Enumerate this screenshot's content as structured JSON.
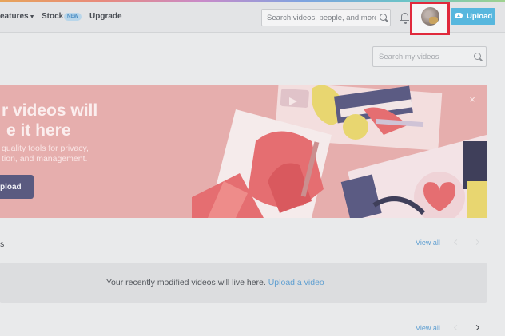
{
  "nav": {
    "features": "eatures",
    "stock": "Stock",
    "new_badge": "NEW",
    "upgrade": "Upgrade"
  },
  "search": {
    "placeholder": "Search videos, people, and more"
  },
  "header": {
    "upload_label": "Upload"
  },
  "library": {
    "search_placeholder": "Search my videos"
  },
  "banner": {
    "headline_1": "r videos will",
    "headline_2": "e it here",
    "body_1": "quality tools for privacy,",
    "body_2": "tion, and management.",
    "cta": "pload",
    "close": "×"
  },
  "recent": {
    "title": "s",
    "view_all": "View all",
    "empty_text": "Your recently modified videos will live here. ",
    "empty_link": "Upload a video"
  },
  "second_section": {
    "view_all": "View all"
  },
  "colors": {
    "accent": "#57b7de",
    "banner_bg": "#e6aead",
    "highlight": "#e0293c",
    "link": "#5f9fd1"
  }
}
